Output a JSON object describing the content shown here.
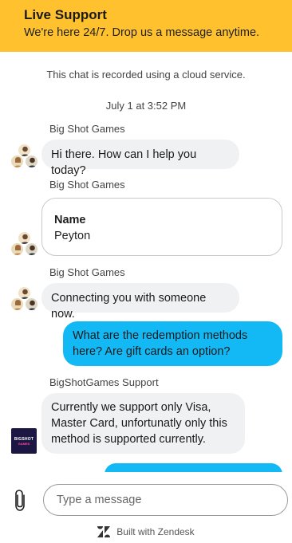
{
  "header": {
    "title": "Live Support",
    "subtitle": "We're here 24/7. Drop us a message anytime.",
    "background_color": "#FFC22E"
  },
  "notice": "This chat is recorded using a cloud service.",
  "timestamp": "July 1 at 3:52 PM",
  "messages": [
    {
      "sender": "Big Shot Games",
      "text": "Hi there. How can I help you today?"
    },
    {
      "sender": "Big Shot Games",
      "form": {
        "label": "Name",
        "value": "Peyton"
      }
    },
    {
      "sender": "Big Shot Games",
      "text": "Connecting you with someone now."
    },
    {
      "from_user": true,
      "text": "What are the redemption methods here? Are gift cards an option?"
    },
    {
      "sender": "BigShotGames Support",
      "text": "Currently we support only Visa, Master Card, unfortunatly only this method is supported currently."
    }
  ],
  "brand_logo_text": "BIGSHOT GAMES",
  "composer": {
    "placeholder": "Type a message",
    "attach_icon": "paperclip-icon"
  },
  "footer": {
    "text": "Built with Zendesk",
    "icon": "zendesk-logo-icon"
  },
  "colors": {
    "accent_header": "#FFC22E",
    "user_bubble": "#13B9F5",
    "agent_bubble": "#F0F1F3"
  }
}
